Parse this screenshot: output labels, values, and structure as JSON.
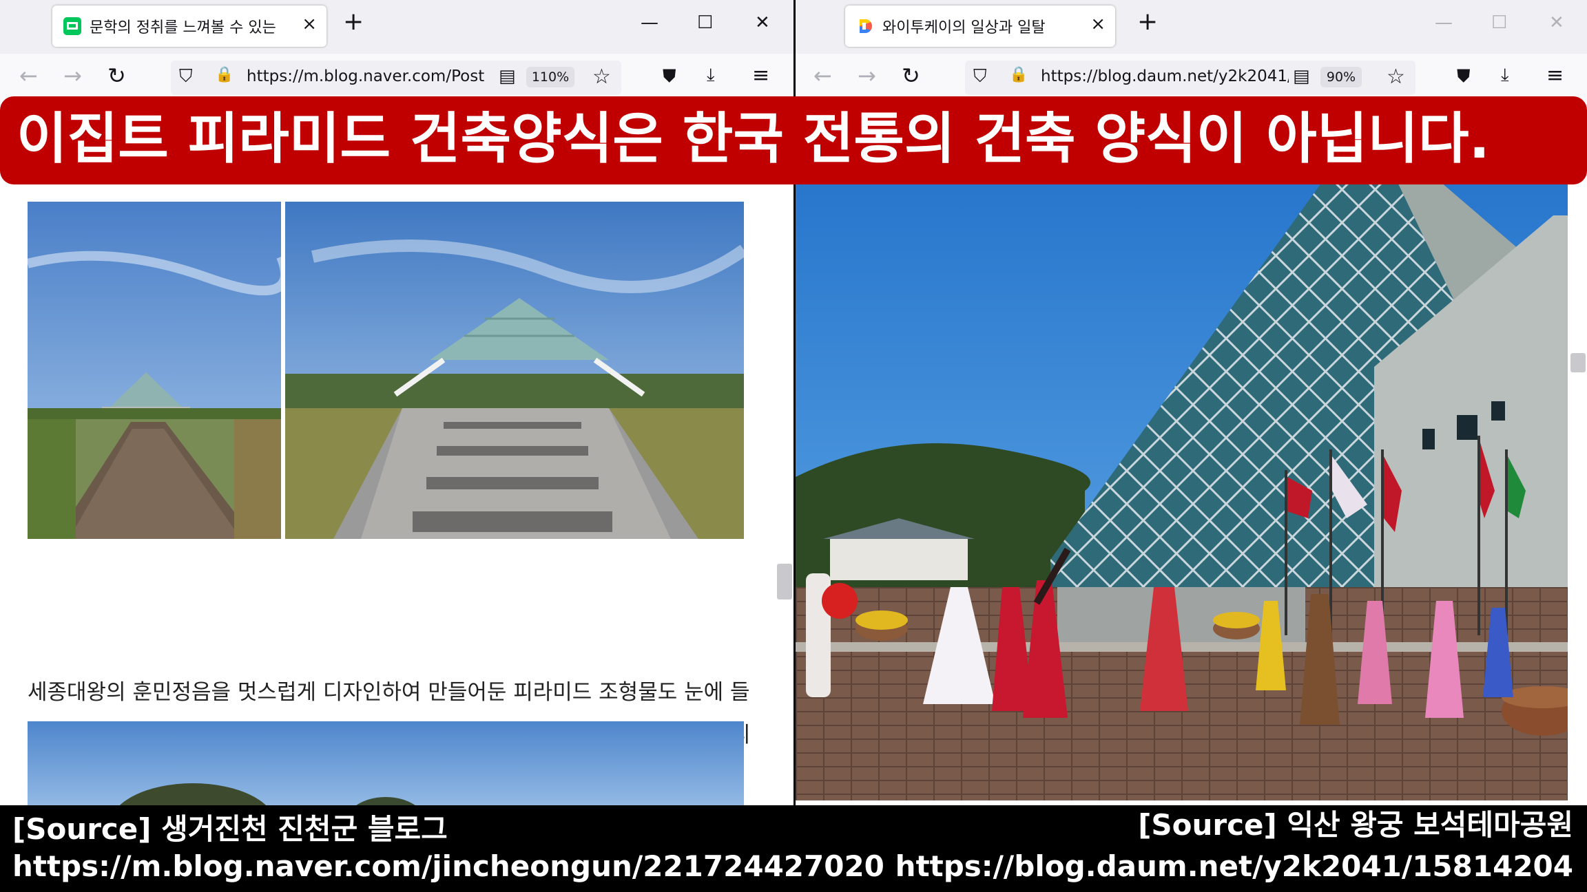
{
  "left_window": {
    "tab_title": "문학의 정취를 느껴볼 수 있는",
    "url": "https://m.blog.naver.com/Post",
    "zoom": "110%",
    "blog_paragraph": "세종대왕의 훈민정음을 멋스럽게 디자인하여 만들어둔 피라미드 조형물도 눈에 들어옵니다. 내부에는 진천 문인 협회 회원분들의 시화들이 걸려있으니 이 곳에 들리게 된다면 한 번씩 눈으로 읽어보시는 것도 좋을 것 같아요."
  },
  "right_window": {
    "tab_title": "와이투케이의 일상과 일탈",
    "url": "https://blog.daum.net/y2k2041/",
    "zoom": "90%"
  },
  "banner": {
    "text": "이집트 피라미드 건축양식은 한국 전통의 건축 양식이 아닙니다."
  },
  "captions": {
    "left_source": "[Source] 생거진천 진천군 블로그",
    "left_url": "https://m.blog.naver.com/jincheongun/221724427020",
    "right_source": "[Source] 익산 왕궁 보석테마공원",
    "right_url": "https://blog.daum.net/y2k2041/15814204"
  },
  "icons": {
    "close": "×",
    "new_tab": "+",
    "minimize": "—",
    "maximize": "☐",
    "window_close": "✕",
    "back": "←",
    "forward": "→",
    "reload": "↻",
    "shield": "⛉",
    "lock": "🔒",
    "reader": "▤",
    "star": "☆",
    "pocket": "⛊",
    "download": "⤓",
    "menu": "≡"
  },
  "colors": {
    "banner": "#c00000",
    "naver": "#03c75a"
  }
}
